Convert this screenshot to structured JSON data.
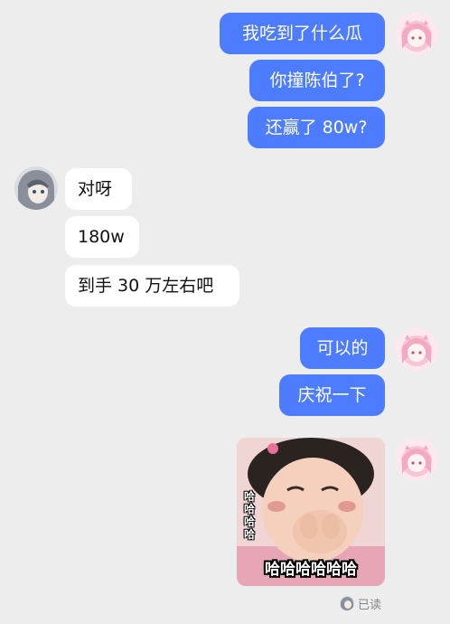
{
  "conversation": {
    "messages": [
      {
        "sender": "me",
        "text": "我吃到了什么瓜"
      },
      {
        "sender": "me",
        "text": "你撞陈伯了?"
      },
      {
        "sender": "me",
        "text": "还赢了 80w?"
      },
      {
        "sender": "them",
        "text": "对呀"
      },
      {
        "sender": "them",
        "text": "180w"
      },
      {
        "sender": "them",
        "text": "到手 30 万左右吧"
      },
      {
        "sender": "me",
        "text": "可以的"
      },
      {
        "sender": "me",
        "text": "庆祝一下"
      }
    ],
    "sticker": {
      "caption": "哈哈哈哈哈哈",
      "side_text": "哈哈哈哈"
    },
    "read_status": "已读"
  },
  "colors": {
    "background": "#ededed",
    "my_bubble": "#4d7cfe",
    "their_bubble": "#ffffff"
  },
  "icons": {
    "my_avatar": "pink-hair-anime-girl-avatar",
    "their_avatar": "grey-hair-anime-girl-avatar"
  }
}
